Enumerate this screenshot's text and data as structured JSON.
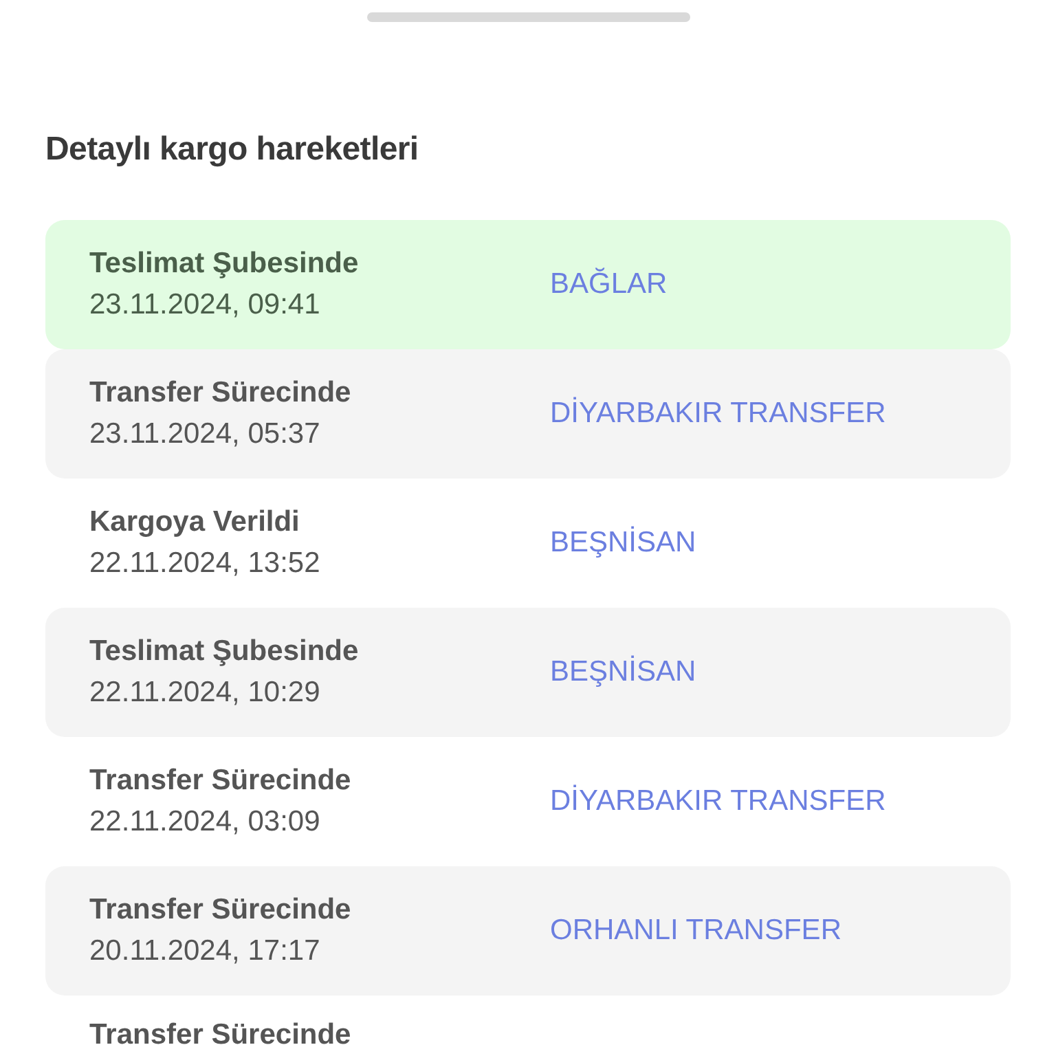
{
  "sheet": {
    "title": "Detaylı kargo hareketleri"
  },
  "movements": [
    {
      "kind": "current",
      "status": "Teslimat Şubesinde",
      "datetime": "23.11.2024, 09:41",
      "location": "BAĞLAR"
    },
    {
      "kind": "shaded",
      "status": "Transfer Sürecinde",
      "datetime": "23.11.2024, 05:37",
      "location": "DİYARBAKIR TRANSFER"
    },
    {
      "kind": "plain",
      "status": "Kargoya Verildi",
      "datetime": "22.11.2024, 13:52",
      "location": "BEŞNİSAN"
    },
    {
      "kind": "shaded",
      "status": "Teslimat Şubesinde",
      "datetime": "22.11.2024, 10:29",
      "location": "BEŞNİSAN"
    },
    {
      "kind": "plain",
      "status": "Transfer Sürecinde",
      "datetime": "22.11.2024, 03:09",
      "location": "DİYARBAKIR TRANSFER"
    },
    {
      "kind": "shaded",
      "status": "Transfer Sürecinde",
      "datetime": "20.11.2024, 17:17",
      "location": "ORHANLI TRANSFER"
    },
    {
      "kind": "plain",
      "status": "Transfer Sürecinde"
    }
  ]
}
